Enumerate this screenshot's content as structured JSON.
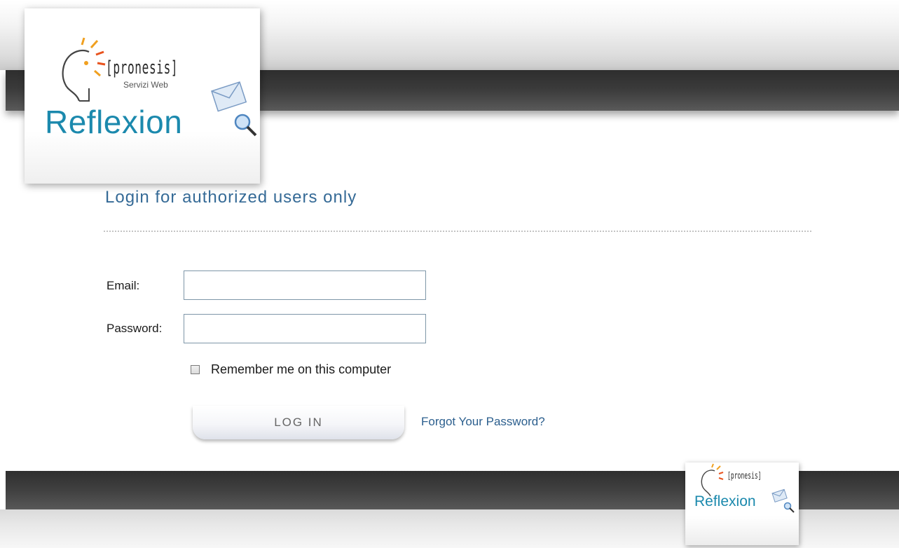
{
  "header": {
    "logo": {
      "company": "[pronesis]",
      "tagline": "Servizi Web",
      "product": "Reflexion"
    }
  },
  "login": {
    "title": "Login for authorized users only",
    "email_label": "Email:",
    "email_value": "",
    "password_label": "Password:",
    "password_value": "",
    "remember_label": "Remember me on this computer",
    "remember_checked": false,
    "login_button": "LOG IN",
    "forgot_link": "Forgot Your Password?"
  },
  "footer": {
    "logo": {
      "company": "[pronesis]",
      "product": "Reflexion"
    }
  },
  "colors": {
    "brand_blue": "#1b89ad",
    "title_blue": "#356a96",
    "link_blue": "#2c5f8e",
    "band_dark": "#3a3a3a"
  },
  "icons": [
    "head-bulb-icon",
    "envelope-magnifier-icon"
  ]
}
